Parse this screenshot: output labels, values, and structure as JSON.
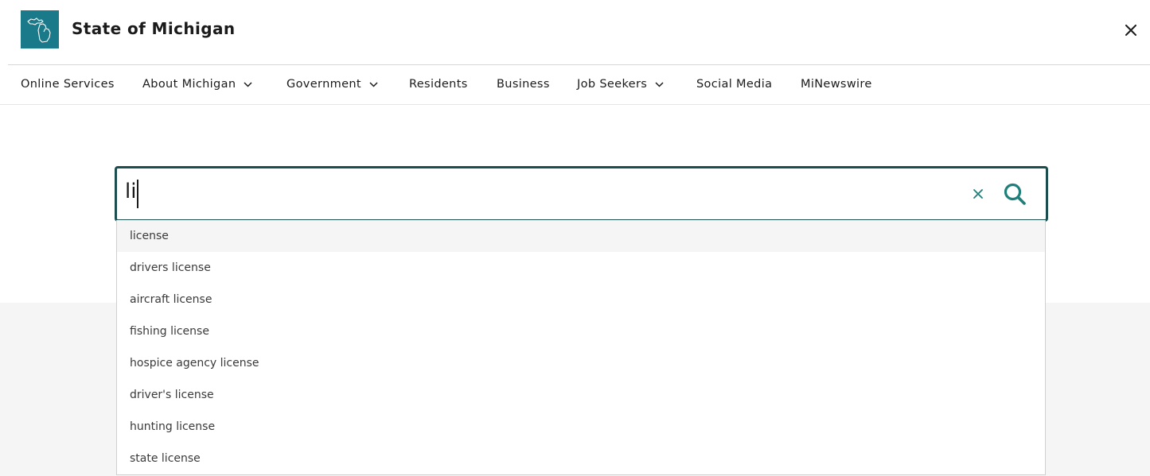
{
  "header": {
    "site_title": "State of Michigan",
    "logo_icon": "michigan-map-icon",
    "close_icon": "close-icon"
  },
  "nav": {
    "items": [
      {
        "label": "Online Services",
        "has_dropdown": false
      },
      {
        "label": "About Michigan",
        "has_dropdown": true
      },
      {
        "label": "Government",
        "has_dropdown": true
      },
      {
        "label": "Residents",
        "has_dropdown": false
      },
      {
        "label": "Business",
        "has_dropdown": false
      },
      {
        "label": "Job Seekers",
        "has_dropdown": true
      },
      {
        "label": "Social Media",
        "has_dropdown": false
      },
      {
        "label": "MiNewswire",
        "has_dropdown": false
      }
    ]
  },
  "search": {
    "value": "li",
    "clear_icon": "clear-icon",
    "search_icon": "search-icon",
    "suggestions": [
      "license",
      "drivers license",
      "aircraft license",
      "fishing license",
      "hospice agency license",
      "driver's license",
      "hunting license",
      "state license"
    ],
    "active_suggestion_index": 0
  },
  "colors": {
    "brand_teal": "#1a7a8a",
    "search_border": "#1b4f4f",
    "accent_icon": "#1f7f7a",
    "grey_band": "#f5f5f5"
  }
}
